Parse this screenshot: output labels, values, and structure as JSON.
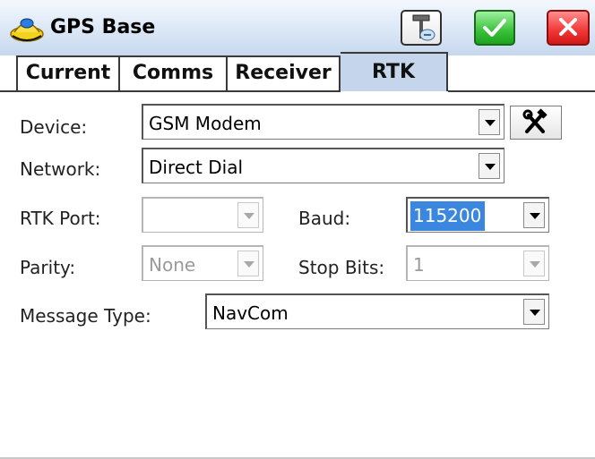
{
  "window": {
    "title": "GPS Base",
    "icons": {
      "app": "gps-base-icon",
      "tools": "survey-tools-icon",
      "ok": "checkmark-icon",
      "cancel": "close-icon"
    },
    "colors": {
      "titlebar": "#dbe7f6",
      "ok": "#38c238",
      "cancel": "#f03636",
      "active_tab": "#c5d6ec",
      "selection": "#3b87e0"
    }
  },
  "tabs": [
    {
      "label": "Current",
      "active": false
    },
    {
      "label": "Comms",
      "active": false
    },
    {
      "label": "Receiver",
      "active": false
    },
    {
      "label": "RTK",
      "active": true
    }
  ],
  "form": {
    "device": {
      "label": "Device:",
      "value": "GSM Modem",
      "tool_icon": "hammer-wrench-icon"
    },
    "network": {
      "label": "Network:",
      "value": "Direct Dial"
    },
    "rtk_port": {
      "label": "RTK Port:",
      "value": "",
      "disabled": true
    },
    "baud": {
      "label": "Baud:",
      "value": "115200",
      "selected": true
    },
    "parity": {
      "label": "Parity:",
      "value": "None",
      "disabled": true
    },
    "stop_bits": {
      "label": "Stop Bits:",
      "value": "1",
      "disabled": true
    },
    "message_type": {
      "label": "Message Type:",
      "value": "NavCom"
    }
  }
}
